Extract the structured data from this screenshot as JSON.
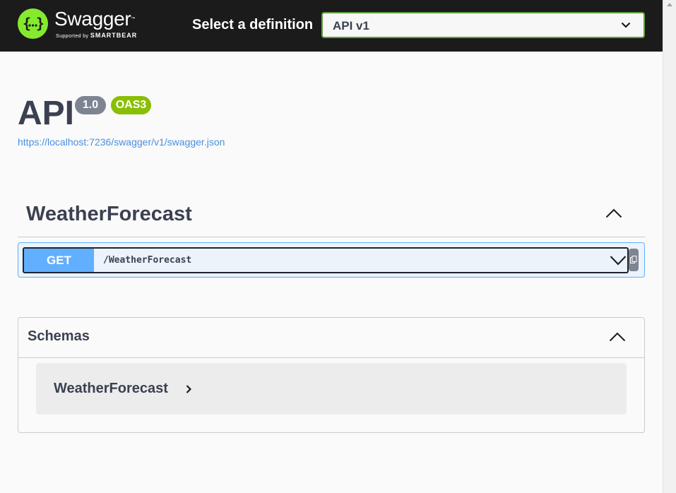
{
  "topbar": {
    "logo_title": "Swagger",
    "logo_tm": "™",
    "logo_supported": "Supported by",
    "logo_brand": "SMARTBEAR",
    "definition_label": "Select a definition",
    "definition_selected": "API v1"
  },
  "info": {
    "title": "API",
    "version": "1.0",
    "oas": "OAS3",
    "spec_url": "https://localhost:7236/swagger/v1/swagger.json"
  },
  "tag": {
    "name": "WeatherForecast",
    "operations": [
      {
        "method": "GET",
        "path": "/WeatherForecast"
      }
    ]
  },
  "schemas": {
    "title": "Schemas",
    "models": [
      {
        "name": "WeatherForecast"
      }
    ]
  },
  "icons": {
    "logo": "swagger-logo-icon",
    "select_arrow": "chevron-down-icon",
    "tag_toggle": "chevron-up-icon",
    "op_toggle": "chevron-down-icon",
    "copy": "copy-icon",
    "schemas_toggle": "chevron-up-icon",
    "model_expand": "chevron-right-icon"
  },
  "colors": {
    "topbar_bg": "#1b1b1b",
    "brand_green": "#85ea2d",
    "select_border": "#62a03f",
    "get_blue": "#61affe",
    "get_bg": "#ebf3fb",
    "version_badge": "#7d8492",
    "oas_badge": "#89bf04",
    "link": "#4990e2"
  }
}
